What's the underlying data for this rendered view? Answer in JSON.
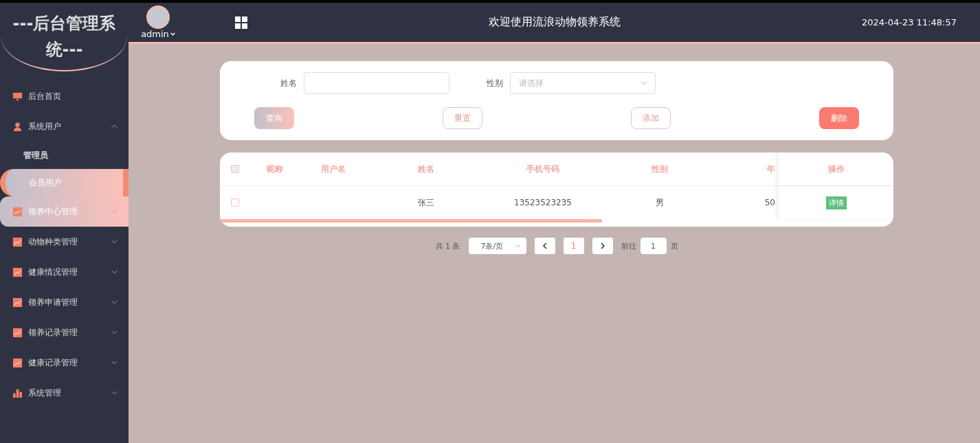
{
  "sidebar": {
    "logo": "---后台管理系统---",
    "items": [
      {
        "label": "后台首页",
        "kind": "link",
        "selected": false
      },
      {
        "label": "系统用户",
        "kind": "group",
        "expanded": true,
        "selected": false,
        "children": [
          {
            "label": "管理员",
            "selected": false
          },
          {
            "label": "会员用户",
            "selected": true
          }
        ]
      },
      {
        "label": "领养中心管理",
        "kind": "group",
        "expanded": false,
        "selected": true
      },
      {
        "label": "动物种类管理",
        "kind": "group",
        "expanded": false,
        "selected": false
      },
      {
        "label": "健康情况管理",
        "kind": "group",
        "expanded": false,
        "selected": false
      },
      {
        "label": "领养申请管理",
        "kind": "group",
        "expanded": false,
        "selected": false
      },
      {
        "label": "领养记录管理",
        "kind": "group",
        "expanded": false,
        "selected": false
      },
      {
        "label": "健康记录管理",
        "kind": "group",
        "expanded": false,
        "selected": false
      },
      {
        "label": "系统管理",
        "kind": "group",
        "expanded": false,
        "selected": false
      }
    ]
  },
  "header": {
    "user": "admin",
    "title": "欢迎使用流浪动物领养系统",
    "datetime": "2024-04-23 11:48:57"
  },
  "search": {
    "fields": [
      {
        "label": "姓名",
        "kind": "input"
      },
      {
        "label": "性别",
        "kind": "select",
        "placeholder": "请选择"
      }
    ],
    "buttons": [
      {
        "label": "查询",
        "kind": "gradient"
      },
      {
        "label": "重置",
        "kind": "outline"
      },
      {
        "label": "添加",
        "kind": "outline"
      },
      {
        "label": "删除",
        "kind": "danger"
      }
    ]
  },
  "table": {
    "columns": [
      "昵称",
      "用户名",
      "姓名",
      "手机号码",
      "性别",
      "年"
    ],
    "action_column": "操作",
    "rows": [
      {
        "checked": false,
        "cells": [
          "",
          "",
          "张三",
          "13523523235",
          "男",
          "50"
        ],
        "action": "详情"
      }
    ],
    "header_checked": false
  },
  "pagination": {
    "total": "共 1 条",
    "page_size": "7条/页",
    "pages": [
      {
        "label": "1",
        "selected": true
      }
    ],
    "goto_label": "前往",
    "goto_value": "1",
    "goto_suffix": "页"
  }
}
